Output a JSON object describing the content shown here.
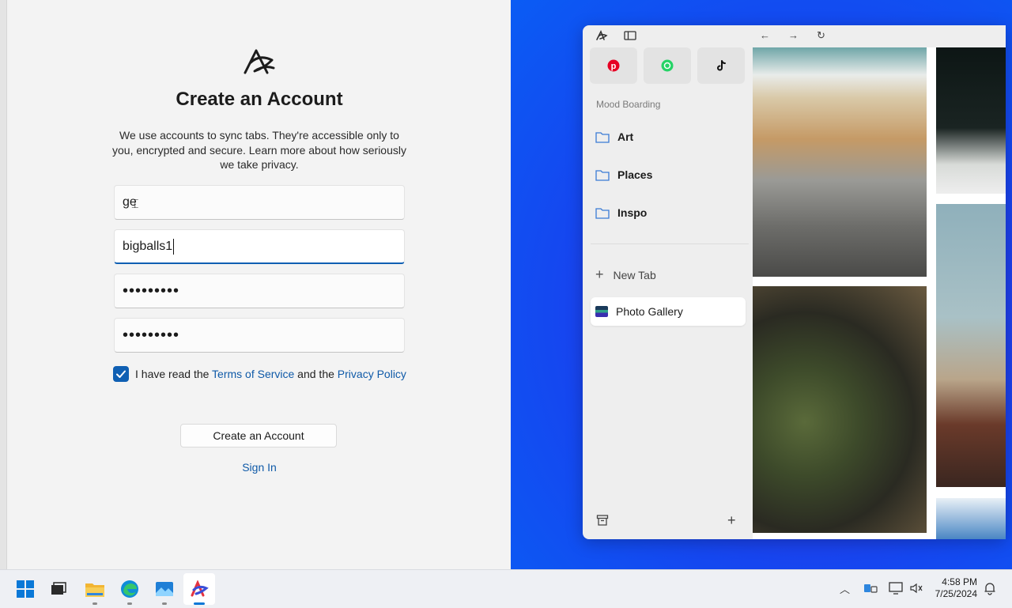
{
  "signup": {
    "title": "Create an Account",
    "description": "We use accounts to sync tabs. They're accessible only to you, encrypted and secure. Learn more about how seriously we take privacy.",
    "fields": {
      "first_value": "ge",
      "second_value": "bigballs1",
      "password_mask": "•••••••••",
      "confirm_mask": "•••••••••"
    },
    "agree": {
      "checked": true,
      "prefix": "I have read the ",
      "terms": "Terms of Service",
      "middle": " and the ",
      "privacy": "Privacy Policy"
    },
    "create_button": "Create an Account",
    "signin_link": "Sign In"
  },
  "arc": {
    "pinned": [
      {
        "icon": "pinterest-icon",
        "color": "#e60023"
      },
      {
        "icon": "whatsapp-icon",
        "color": "#25d366"
      },
      {
        "icon": "tiktok-icon",
        "color": "#111111"
      }
    ],
    "space_name": "Mood Boarding",
    "folders": [
      "Art",
      "Places",
      "Inspo"
    ],
    "new_tab_label": "New Tab",
    "active_tab": "Photo Gallery"
  },
  "taskbar": {
    "apps": [
      "start-icon",
      "task-view-icon",
      "file-explorer-icon",
      "edge-icon",
      "photos-icon",
      "arc-icon"
    ],
    "time": "4:58 PM",
    "date": "7/25/2024"
  },
  "colors": {
    "accent": "#0f5fb3",
    "link": "#0f5aa8",
    "desktop": "#1547f0"
  }
}
